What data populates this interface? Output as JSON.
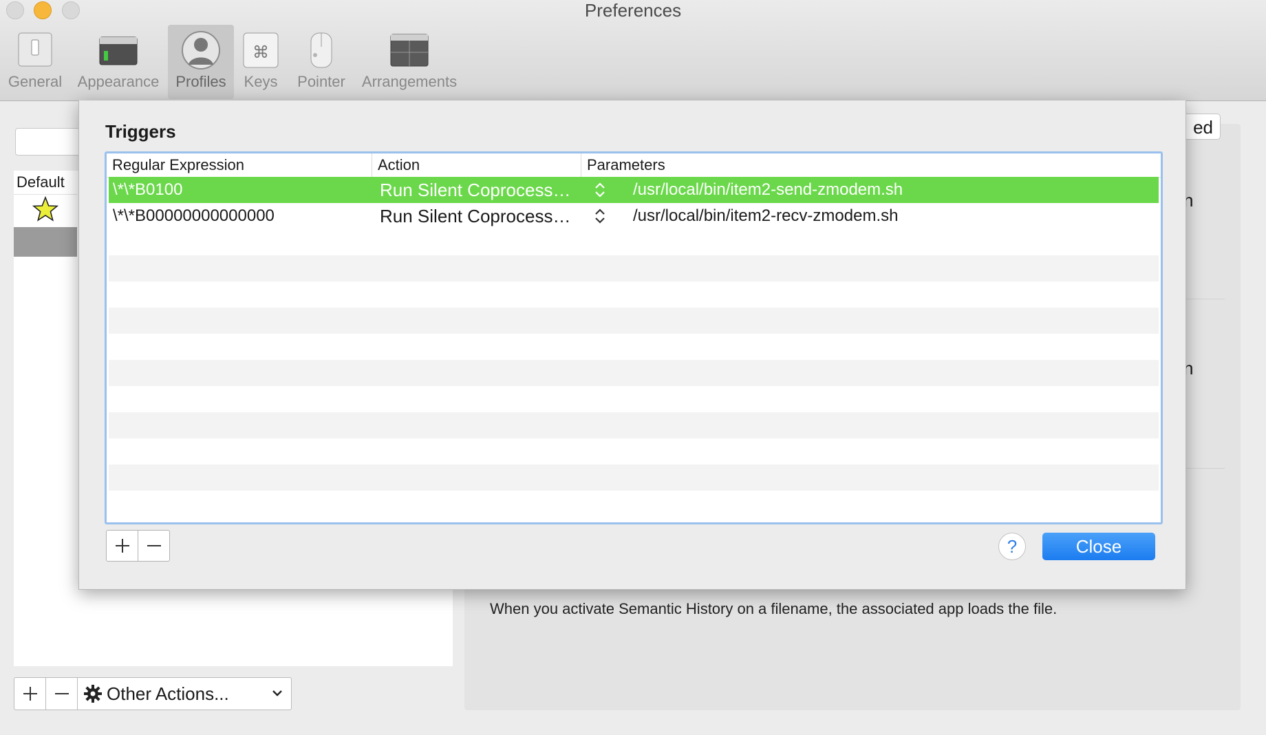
{
  "window": {
    "title": "Preferences"
  },
  "toolbar": {
    "items": [
      {
        "label": "General",
        "icon": "switch-icon"
      },
      {
        "label": "Appearance",
        "icon": "window-icon"
      },
      {
        "label": "Profiles",
        "icon": "person-icon",
        "selected": true
      },
      {
        "label": "Keys",
        "icon": "command-key-icon"
      },
      {
        "label": "Pointer",
        "icon": "mouse-icon"
      },
      {
        "label": "Arrangements",
        "icon": "windows-icon"
      }
    ]
  },
  "profiles_list": {
    "header": "Default",
    "default_marker": "★"
  },
  "right_pane": {
    "tab_fragment": "ed",
    "fragment_1": "n",
    "fragment_2": "n",
    "semantic_history_text": "When you activate Semantic History on a filename, the associated app loads the file."
  },
  "bottom_controls": {
    "add": "+",
    "remove": "—",
    "other_actions": "Other Actions..."
  },
  "triggers_sheet": {
    "title": "Triggers",
    "columns": [
      "Regular Expression",
      "Action",
      "Parameters"
    ],
    "rows": [
      {
        "regex": "\\*\\*B0100",
        "action": "Run Silent Coprocess…",
        "parameters": "/usr/local/bin/item2-send-zmodem.sh",
        "selected": true
      },
      {
        "regex": "\\*\\*B00000000000000",
        "action": "Run Silent Coprocess…",
        "parameters": "/usr/local/bin/item2-recv-zmodem.sh",
        "selected": false
      }
    ],
    "add": "+",
    "remove": "—",
    "help": "?",
    "close": "Close"
  },
  "colors": {
    "selection_green": "#6ad84a",
    "focus_ring": "#9ac0ee",
    "primary_button": "#1c7cf0",
    "close_traffic": "#d9d9d9",
    "minimize_traffic": "#f6b73a"
  }
}
